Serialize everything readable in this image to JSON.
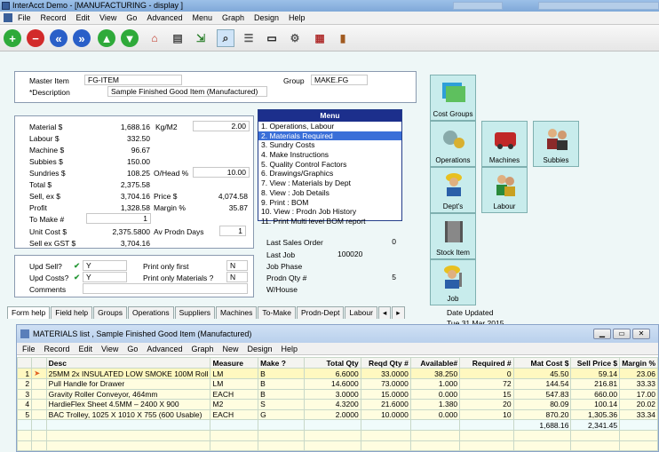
{
  "window_title": "InterAcct Demo - [MANUFACTURING - display ]",
  "menubar": [
    "File",
    "Record",
    "Edit",
    "View",
    "Go",
    "Advanced",
    "Menu",
    "Graph",
    "Design",
    "Help"
  ],
  "header": {
    "master_item_label": "Master Item",
    "master_item_value": "FG-ITEM",
    "description_label": "*Description",
    "description_value": "Sample Finished Good Item (Manufactured)",
    "group_label": "Group",
    "group_value": "MAKE.FG"
  },
  "costs": {
    "material_label": "Material $",
    "material_value": "1,688.16",
    "labour_label": "Labour  $",
    "labour_value": "332.50",
    "machine_label": "Machine $",
    "machine_value": "96.67",
    "subbies_label": "Subbies $",
    "subbies_value": "150.00",
    "sundries_label": "Sundries $",
    "sundries_value": "108.25",
    "total_label": "Total   $",
    "total_value": "2,375.58",
    "sell_label": "Sell, ex $",
    "sell_value": "3,704.16",
    "profit_label": "Profit",
    "profit_value": "1,328.58",
    "tomake_label": "To Make #",
    "tomake_value": "1",
    "unitcost_label": "Unit Cost $",
    "unitcost_value": "2,375.5800",
    "sellgst_label": "Sell ex GST $",
    "sellgst_value": "3,704.16",
    "kgm2_label": "Kg/M2",
    "kgm2_value": "2.00",
    "ohead_label": "O/Head %",
    "ohead_value": "10.00",
    "price_label": "Price $",
    "price_value": "4,074.58",
    "margin_label": "Margin %",
    "margin_value": "35.87",
    "avprodn_label": "Av Prodn Days",
    "avprodn_value": "1"
  },
  "menu": {
    "title": "Menu",
    "items": [
      "1. Operations, Labour",
      "2. Materials Required",
      "3. Sundry Costs",
      "4. Make Instructions",
      "5. Quality Control Factors",
      "6. Drawings/Graphics",
      "7. View : Materials by Dept",
      "8. View : Job Details",
      "9. Print : BOM",
      "10. View : Prodn Job History",
      "11. Print Multi level BOM report"
    ]
  },
  "info": {
    "last_sales_order_label": "Last Sales Order",
    "last_sales_order_value": "0",
    "last_job_label": "Last Job",
    "last_job_value": "100020",
    "job_phase_label": "Job Phase",
    "prodn_qty_label": "Prodn Qty #",
    "prodn_qty_value": "5",
    "whouse_label": "W/House",
    "date_updated_label": "Date Updated",
    "date_updated_value": "Tue 31 Mar 2015"
  },
  "flags": {
    "upd_sell_label": "Upd Sell?",
    "upd_sell_value": "Y",
    "upd_costs_label": "Upd Costs?",
    "upd_costs_value": "Y",
    "comments_label": "Comments",
    "print_only_first_label": "Print only first",
    "print_only_first_value": "N",
    "print_only_materials_label": "Print only Materials ?",
    "print_only_materials_value": "N"
  },
  "tiles": [
    "Cost Groups",
    "Operations",
    "Machines",
    "Subbies",
    "Dept's",
    "Labour",
    "Stock Item",
    "Job"
  ],
  "tabs": [
    "Form help",
    "Field help",
    "Groups",
    "Operations",
    "Suppliers",
    "Machines",
    "To-Make",
    "Prodn-Dept",
    "Labour"
  ],
  "child": {
    "title": "MATERIALS list , Sample Finished Good Item (Manufactured)",
    "menubar": [
      "File",
      "Record",
      "Edit",
      "View",
      "Go",
      "Advanced",
      "Graph",
      "New",
      "Design",
      "Help"
    ],
    "columns": [
      "Desc",
      "Measure",
      "Make ?",
      "Total Qty",
      "Reqd Qty #",
      "Available#",
      "Required #",
      "Mat Cost  $",
      "Sell Price $",
      "Margin %"
    ],
    "rows": [
      {
        "n": "1",
        "desc": "25MM 2x INSULATED LOW SMOKE 100M Roll",
        "measure": "LM",
        "make": "B",
        "total": "6.6000",
        "reqd": "33.0000",
        "avail": "38.250",
        "required": "0",
        "matcost": "45.50",
        "sell": "59.14",
        "margin": "23.06"
      },
      {
        "n": "2",
        "desc": "Pull Handle for Drawer",
        "measure": "LM",
        "make": "B",
        "total": "14.6000",
        "reqd": "73.0000",
        "avail": "1.000",
        "required": "72",
        "matcost": "144.54",
        "sell": "216.81",
        "margin": "33.33"
      },
      {
        "n": "3",
        "desc": "Gravity Roller Conveyor, 464mm",
        "measure": "EACH",
        "make": "B",
        "total": "3.0000",
        "reqd": "15.0000",
        "avail": "0.000",
        "required": "15",
        "matcost": "547.83",
        "sell": "660.00",
        "margin": "17.00"
      },
      {
        "n": "4",
        "desc": "HardieFlex Sheet 4.5MM – 2400 X 900",
        "measure": "M2",
        "make": "S",
        "total": "4.3200",
        "reqd": "21.6000",
        "avail": "1.380",
        "required": "20",
        "matcost": "80.09",
        "sell": "100.14",
        "margin": "20.02"
      },
      {
        "n": "5",
        "desc": "BAC Trolley, 1025 X 1010 X 755 (600 Usable)",
        "measure": "EACH",
        "make": "G",
        "total": "2.0000",
        "reqd": "10.0000",
        "avail": "0.000",
        "required": "10",
        "matcost": "870.20",
        "sell": "1,305.36",
        "margin": "33.34"
      }
    ],
    "totals": {
      "matcost": "1,688.16",
      "sell": "2,341.45"
    }
  }
}
